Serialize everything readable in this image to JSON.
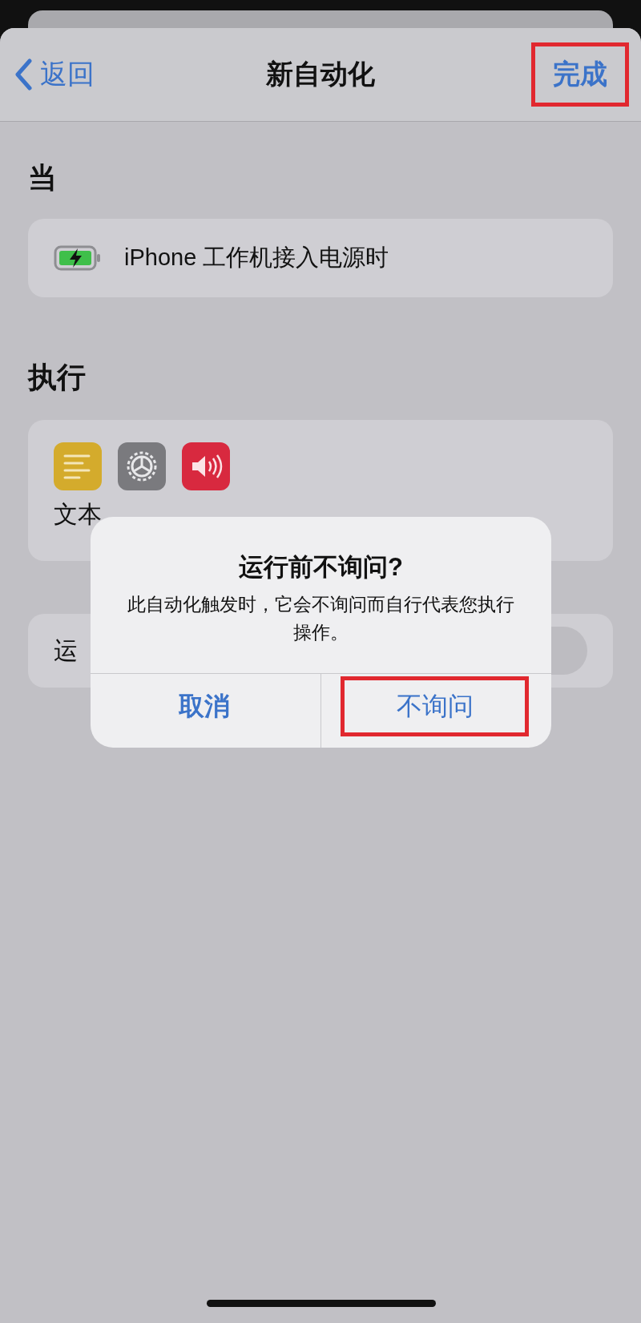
{
  "nav": {
    "back": "返回",
    "title": "新自动化",
    "done": {
      "label": "完成",
      "highlighted": true
    }
  },
  "trigger": {
    "header": "当",
    "text": "iPhone 工作机接入电源时"
  },
  "actions": {
    "header": "执行",
    "summary": "文本"
  },
  "run_row": {
    "label": "运",
    "on": false
  },
  "alert": {
    "title": "运行前不询问?",
    "message": "此自动化触发时，它会不询问而自行代表您执行操作。",
    "buttons": [
      {
        "label": "取消",
        "bold": true,
        "highlighted": false
      },
      {
        "label": "不询问",
        "bold": false,
        "highlighted": true
      }
    ]
  }
}
